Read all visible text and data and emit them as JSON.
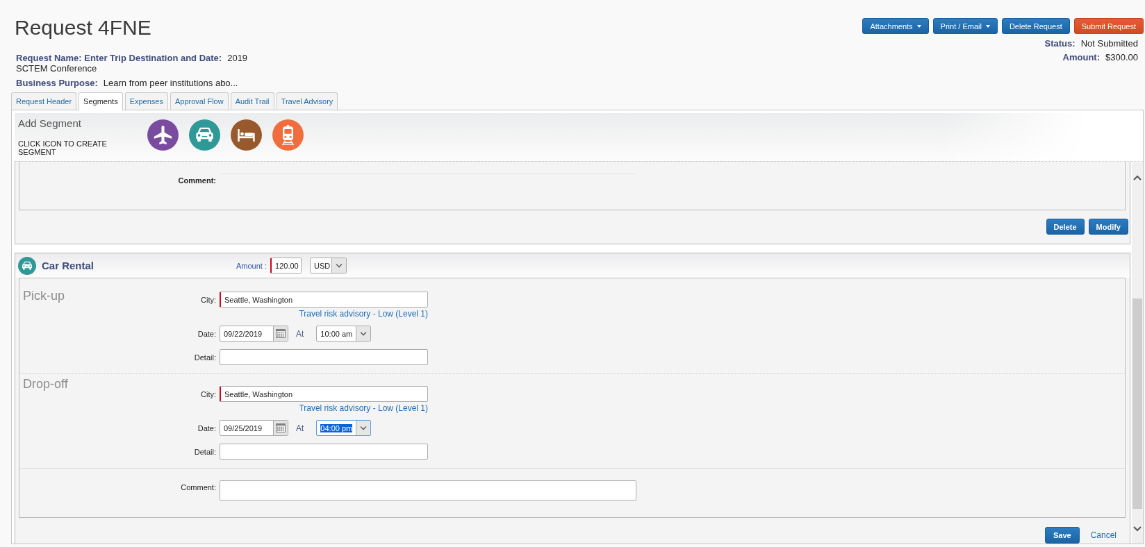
{
  "page": {
    "title": "Request 4FNE"
  },
  "actions": [
    {
      "label": "Attachments",
      "kind": "dropdown"
    },
    {
      "label": "Print / Email",
      "kind": "dropdown"
    },
    {
      "label": "Delete Request",
      "kind": "primary"
    },
    {
      "label": "Submit Request",
      "kind": "submit"
    }
  ],
  "summary": {
    "request_name": {
      "label": "Request Name: Enter Trip Destination and Date:",
      "value_lines": [
        "2019",
        "SCTEM Conference"
      ]
    },
    "business_purpose": {
      "label": "Business Purpose:",
      "value": "Learn from peer institutions abo..."
    }
  },
  "status": [
    {
      "label": "Status:",
      "value": "Not Submitted"
    },
    {
      "label": "Amount:",
      "value": "$300.00"
    }
  ],
  "tabs": [
    {
      "label": "Request Header",
      "selected": false
    },
    {
      "label": "Segments",
      "selected": true
    },
    {
      "label": "Expenses",
      "selected": false
    },
    {
      "label": "Approval Flow",
      "selected": false
    },
    {
      "label": "Audit Trail",
      "selected": false
    },
    {
      "label": "Travel Advisory",
      "selected": false
    }
  ],
  "add_segment": {
    "title": "Add Segment",
    "hint": "CLICK ICON TO CREATE SEGMENT",
    "segment_types": [
      {
        "kind": "air",
        "color": "#7a4c9f"
      },
      {
        "kind": "car",
        "color": "#2e9996"
      },
      {
        "kind": "hotel",
        "color": "#985a2c"
      },
      {
        "kind": "rail",
        "color": "#f06d3d"
      }
    ]
  },
  "previous_segment": {
    "comment_label": "Comment:",
    "buttons": [
      {
        "label": "Delete"
      },
      {
        "label": "Modify"
      }
    ]
  },
  "car_rental": {
    "title": "Car Rental",
    "amount_label": "Amount :",
    "amount": {
      "value": "120.00",
      "required": true
    },
    "currency": "USD",
    "legs": [
      {
        "title": "Pick-up",
        "city_label": "City:",
        "city": {
          "value": "Seattle, Washington",
          "required": true
        },
        "advisory": "Travel risk advisory - Low (Level 1)",
        "date_label": "Date:",
        "date": "09/22/2019",
        "at_label": "At",
        "time": {
          "value": "10:00 am",
          "focused": false
        },
        "detail_label": "Detail:"
      },
      {
        "title": "Drop-off",
        "city_label": "City:",
        "city": {
          "value": "Seattle, Washington",
          "required": true
        },
        "advisory": "Travel risk advisory - Low (Level 1)",
        "date_label": "Date:",
        "date": "09/25/2019",
        "at_label": "At",
        "time": {
          "value": "04:00 pm",
          "focused": true
        },
        "detail_label": "Detail:"
      }
    ],
    "comment_label": "Comment:",
    "buttons": [
      {
        "label": "Save",
        "kind": "button"
      },
      {
        "label": "Cancel",
        "kind": "link"
      }
    ]
  }
}
